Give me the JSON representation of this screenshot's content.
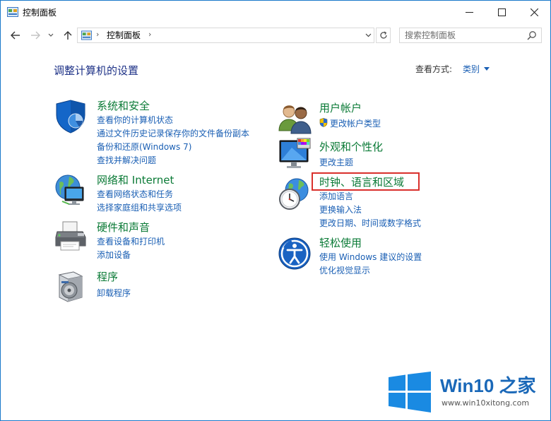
{
  "window": {
    "title": "控制面板"
  },
  "address": {
    "crumbs": [
      "控制面板"
    ],
    "search_placeholder": "搜索控制面板"
  },
  "header": {
    "title": "调整计算机的设置",
    "view_by_label": "查看方式:",
    "view_by_value": "类别"
  },
  "categories": [
    {
      "title": "系统和安全",
      "icon": "system-security-shield-icon",
      "links": [
        "查看你的计算机状态",
        "通过文件历史记录保存你的文件备份副本",
        "备份和还原(Windows 7)",
        "查找并解决问题"
      ]
    },
    {
      "title": "网络和 Internet",
      "icon": "network-globe-icon",
      "links": [
        "查看网络状态和任务",
        "选择家庭组和共享选项"
      ]
    },
    {
      "title": "硬件和声音",
      "icon": "printer-hardware-icon",
      "links": [
        "查看设备和打印机",
        "添加设备"
      ]
    },
    {
      "title": "程序",
      "icon": "programs-disc-icon",
      "links": [
        "卸载程序"
      ]
    },
    {
      "title": "用户帐户",
      "icon": "user-accounts-icon",
      "links": [
        "更改帐户类型"
      ]
    },
    {
      "title": "外观和个性化",
      "icon": "appearance-monitor-icon",
      "links": [
        "更改主题"
      ]
    },
    {
      "title": "时钟、语言和区域",
      "icon": "clock-globe-icon",
      "links": [
        "添加语言",
        "更换输入法",
        "更改日期、时间或数字格式"
      ]
    },
    {
      "title": "轻松使用",
      "icon": "ease-of-access-icon",
      "links": [
        "使用 Windows 建议的设置",
        "优化视觉显示"
      ]
    }
  ],
  "watermark": {
    "title": "Win10 之家",
    "url": "www.win10xitong.com"
  },
  "colors": {
    "category_title": "#0a7a36",
    "link": "#1a5fb4",
    "heading": "#1e3287",
    "highlight": "#d9302c",
    "window_border": "#1979ca"
  }
}
